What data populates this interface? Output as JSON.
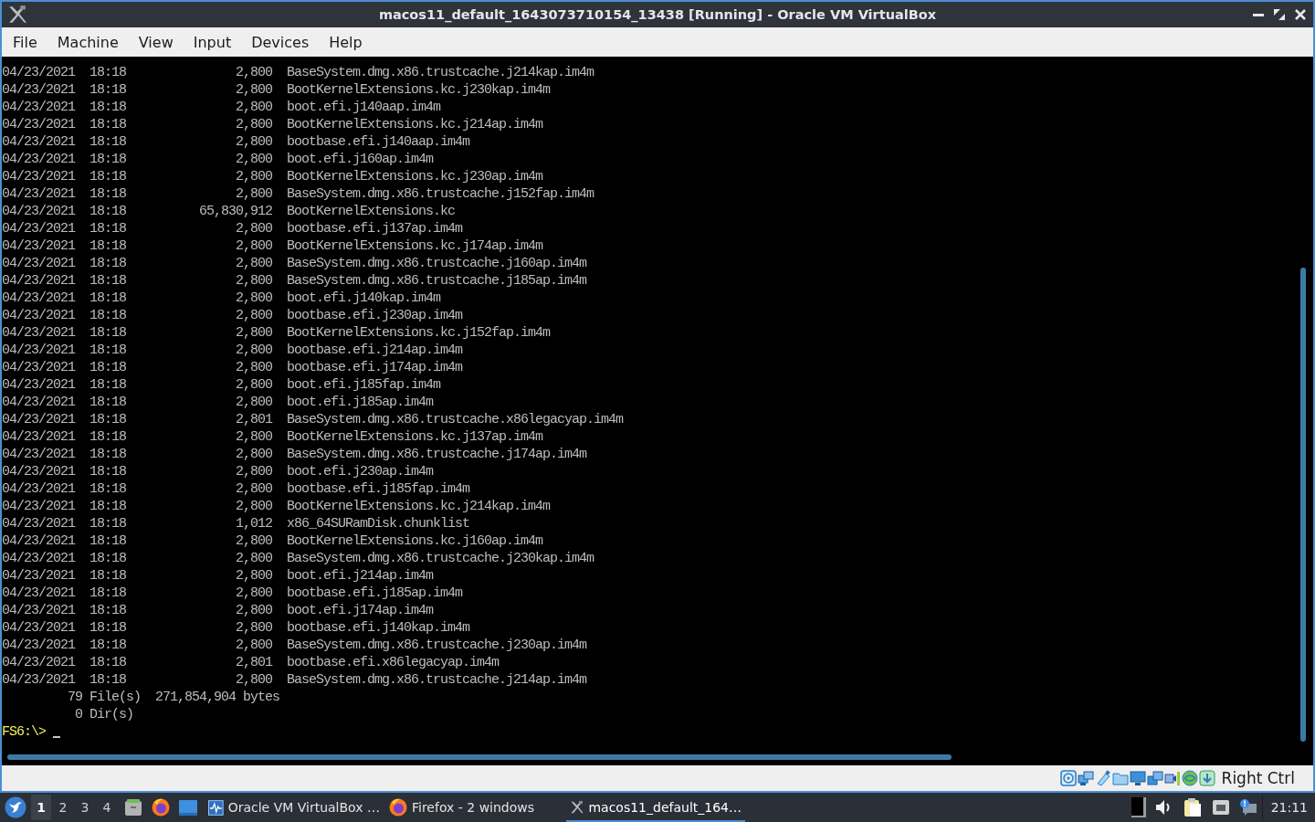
{
  "window": {
    "title": "macos11_default_1643073710154_13438 [Running] - Oracle VM VirtualBox"
  },
  "menu_bar": [
    "File",
    "Machine",
    "View",
    "Input",
    "Devices",
    "Help"
  ],
  "terminal": {
    "files": [
      {
        "date": "04/23/2021",
        "time": "18:18",
        "size": "2,800",
        "name": "BaseSystem.dmg.x86.trustcache.j214kap.im4m"
      },
      {
        "date": "04/23/2021",
        "time": "18:18",
        "size": "2,800",
        "name": "BootKernelExtensions.kc.j230kap.im4m"
      },
      {
        "date": "04/23/2021",
        "time": "18:18",
        "size": "2,800",
        "name": "boot.efi.j140aap.im4m"
      },
      {
        "date": "04/23/2021",
        "time": "18:18",
        "size": "2,800",
        "name": "BootKernelExtensions.kc.j214ap.im4m"
      },
      {
        "date": "04/23/2021",
        "time": "18:18",
        "size": "2,800",
        "name": "bootbase.efi.j140aap.im4m"
      },
      {
        "date": "04/23/2021",
        "time": "18:18",
        "size": "2,800",
        "name": "boot.efi.j160ap.im4m"
      },
      {
        "date": "04/23/2021",
        "time": "18:18",
        "size": "2,800",
        "name": "BootKernelExtensions.kc.j230ap.im4m"
      },
      {
        "date": "04/23/2021",
        "time": "18:18",
        "size": "2,800",
        "name": "BaseSystem.dmg.x86.trustcache.j152fap.im4m"
      },
      {
        "date": "04/23/2021",
        "time": "18:18",
        "size": "65,830,912",
        "name": "BootKernelExtensions.kc"
      },
      {
        "date": "04/23/2021",
        "time": "18:18",
        "size": "2,800",
        "name": "bootbase.efi.j137ap.im4m"
      },
      {
        "date": "04/23/2021",
        "time": "18:18",
        "size": "2,800",
        "name": "BootKernelExtensions.kc.j174ap.im4m"
      },
      {
        "date": "04/23/2021",
        "time": "18:18",
        "size": "2,800",
        "name": "BaseSystem.dmg.x86.trustcache.j160ap.im4m"
      },
      {
        "date": "04/23/2021",
        "time": "18:18",
        "size": "2,800",
        "name": "BaseSystem.dmg.x86.trustcache.j185ap.im4m"
      },
      {
        "date": "04/23/2021",
        "time": "18:18",
        "size": "2,800",
        "name": "boot.efi.j140kap.im4m"
      },
      {
        "date": "04/23/2021",
        "time": "18:18",
        "size": "2,800",
        "name": "bootbase.efi.j230ap.im4m"
      },
      {
        "date": "04/23/2021",
        "time": "18:18",
        "size": "2,800",
        "name": "BootKernelExtensions.kc.j152fap.im4m"
      },
      {
        "date": "04/23/2021",
        "time": "18:18",
        "size": "2,800",
        "name": "bootbase.efi.j214ap.im4m"
      },
      {
        "date": "04/23/2021",
        "time": "18:18",
        "size": "2,800",
        "name": "bootbase.efi.j174ap.im4m"
      },
      {
        "date": "04/23/2021",
        "time": "18:18",
        "size": "2,800",
        "name": "boot.efi.j185fap.im4m"
      },
      {
        "date": "04/23/2021",
        "time": "18:18",
        "size": "2,800",
        "name": "boot.efi.j185ap.im4m"
      },
      {
        "date": "04/23/2021",
        "time": "18:18",
        "size": "2,801",
        "name": "BaseSystem.dmg.x86.trustcache.x86legacyap.im4m"
      },
      {
        "date": "04/23/2021",
        "time": "18:18",
        "size": "2,800",
        "name": "BootKernelExtensions.kc.j137ap.im4m"
      },
      {
        "date": "04/23/2021",
        "time": "18:18",
        "size": "2,800",
        "name": "BaseSystem.dmg.x86.trustcache.j174ap.im4m"
      },
      {
        "date": "04/23/2021",
        "time": "18:18",
        "size": "2,800",
        "name": "boot.efi.j230ap.im4m"
      },
      {
        "date": "04/23/2021",
        "time": "18:18",
        "size": "2,800",
        "name": "bootbase.efi.j185fap.im4m"
      },
      {
        "date": "04/23/2021",
        "time": "18:18",
        "size": "2,800",
        "name": "BootKernelExtensions.kc.j214kap.im4m"
      },
      {
        "date": "04/23/2021",
        "time": "18:18",
        "size": "1,012",
        "name": "x86_64SURamDisk.chunklist"
      },
      {
        "date": "04/23/2021",
        "time": "18:18",
        "size": "2,800",
        "name": "BootKernelExtensions.kc.j160ap.im4m"
      },
      {
        "date": "04/23/2021",
        "time": "18:18",
        "size": "2,800",
        "name": "BaseSystem.dmg.x86.trustcache.j230kap.im4m"
      },
      {
        "date": "04/23/2021",
        "time": "18:18",
        "size": "2,800",
        "name": "boot.efi.j214ap.im4m"
      },
      {
        "date": "04/23/2021",
        "time": "18:18",
        "size": "2,800",
        "name": "bootbase.efi.j185ap.im4m"
      },
      {
        "date": "04/23/2021",
        "time": "18:18",
        "size": "2,800",
        "name": "boot.efi.j174ap.im4m"
      },
      {
        "date": "04/23/2021",
        "time": "18:18",
        "size": "2,800",
        "name": "bootbase.efi.j140kap.im4m"
      },
      {
        "date": "04/23/2021",
        "time": "18:18",
        "size": "2,800",
        "name": "BaseSystem.dmg.x86.trustcache.j230ap.im4m"
      },
      {
        "date": "04/23/2021",
        "time": "18:18",
        "size": "2,801",
        "name": "bootbase.efi.x86legacyap.im4m"
      },
      {
        "date": "04/23/2021",
        "time": "18:18",
        "size": "2,800",
        "name": "BaseSystem.dmg.x86.trustcache.j214ap.im4m"
      }
    ],
    "summary": [
      {
        "count": "79",
        "label": "File(s)",
        "total": "271,854,904 bytes"
      },
      {
        "count": "0",
        "label": "Dir(s)"
      }
    ],
    "prompt": "FS6:\\>"
  },
  "status_bar": {
    "host_key": "Right Ctrl"
  },
  "taskbar": {
    "workspaces": [
      {
        "label": "1",
        "selected": true
      },
      {
        "label": "2",
        "selected": false
      },
      {
        "label": "3",
        "selected": false
      },
      {
        "label": "4",
        "selected": false
      }
    ],
    "tasks": [
      {
        "kind": "pulse",
        "label": "Oracle VM VirtualBox …",
        "selected": false
      },
      {
        "kind": "browser",
        "label": "Firefox - 2 windows",
        "selected": false
      },
      {
        "kind": "vm",
        "label": "macos11_default_164…",
        "selected": true
      }
    ],
    "clock": "21:11"
  }
}
